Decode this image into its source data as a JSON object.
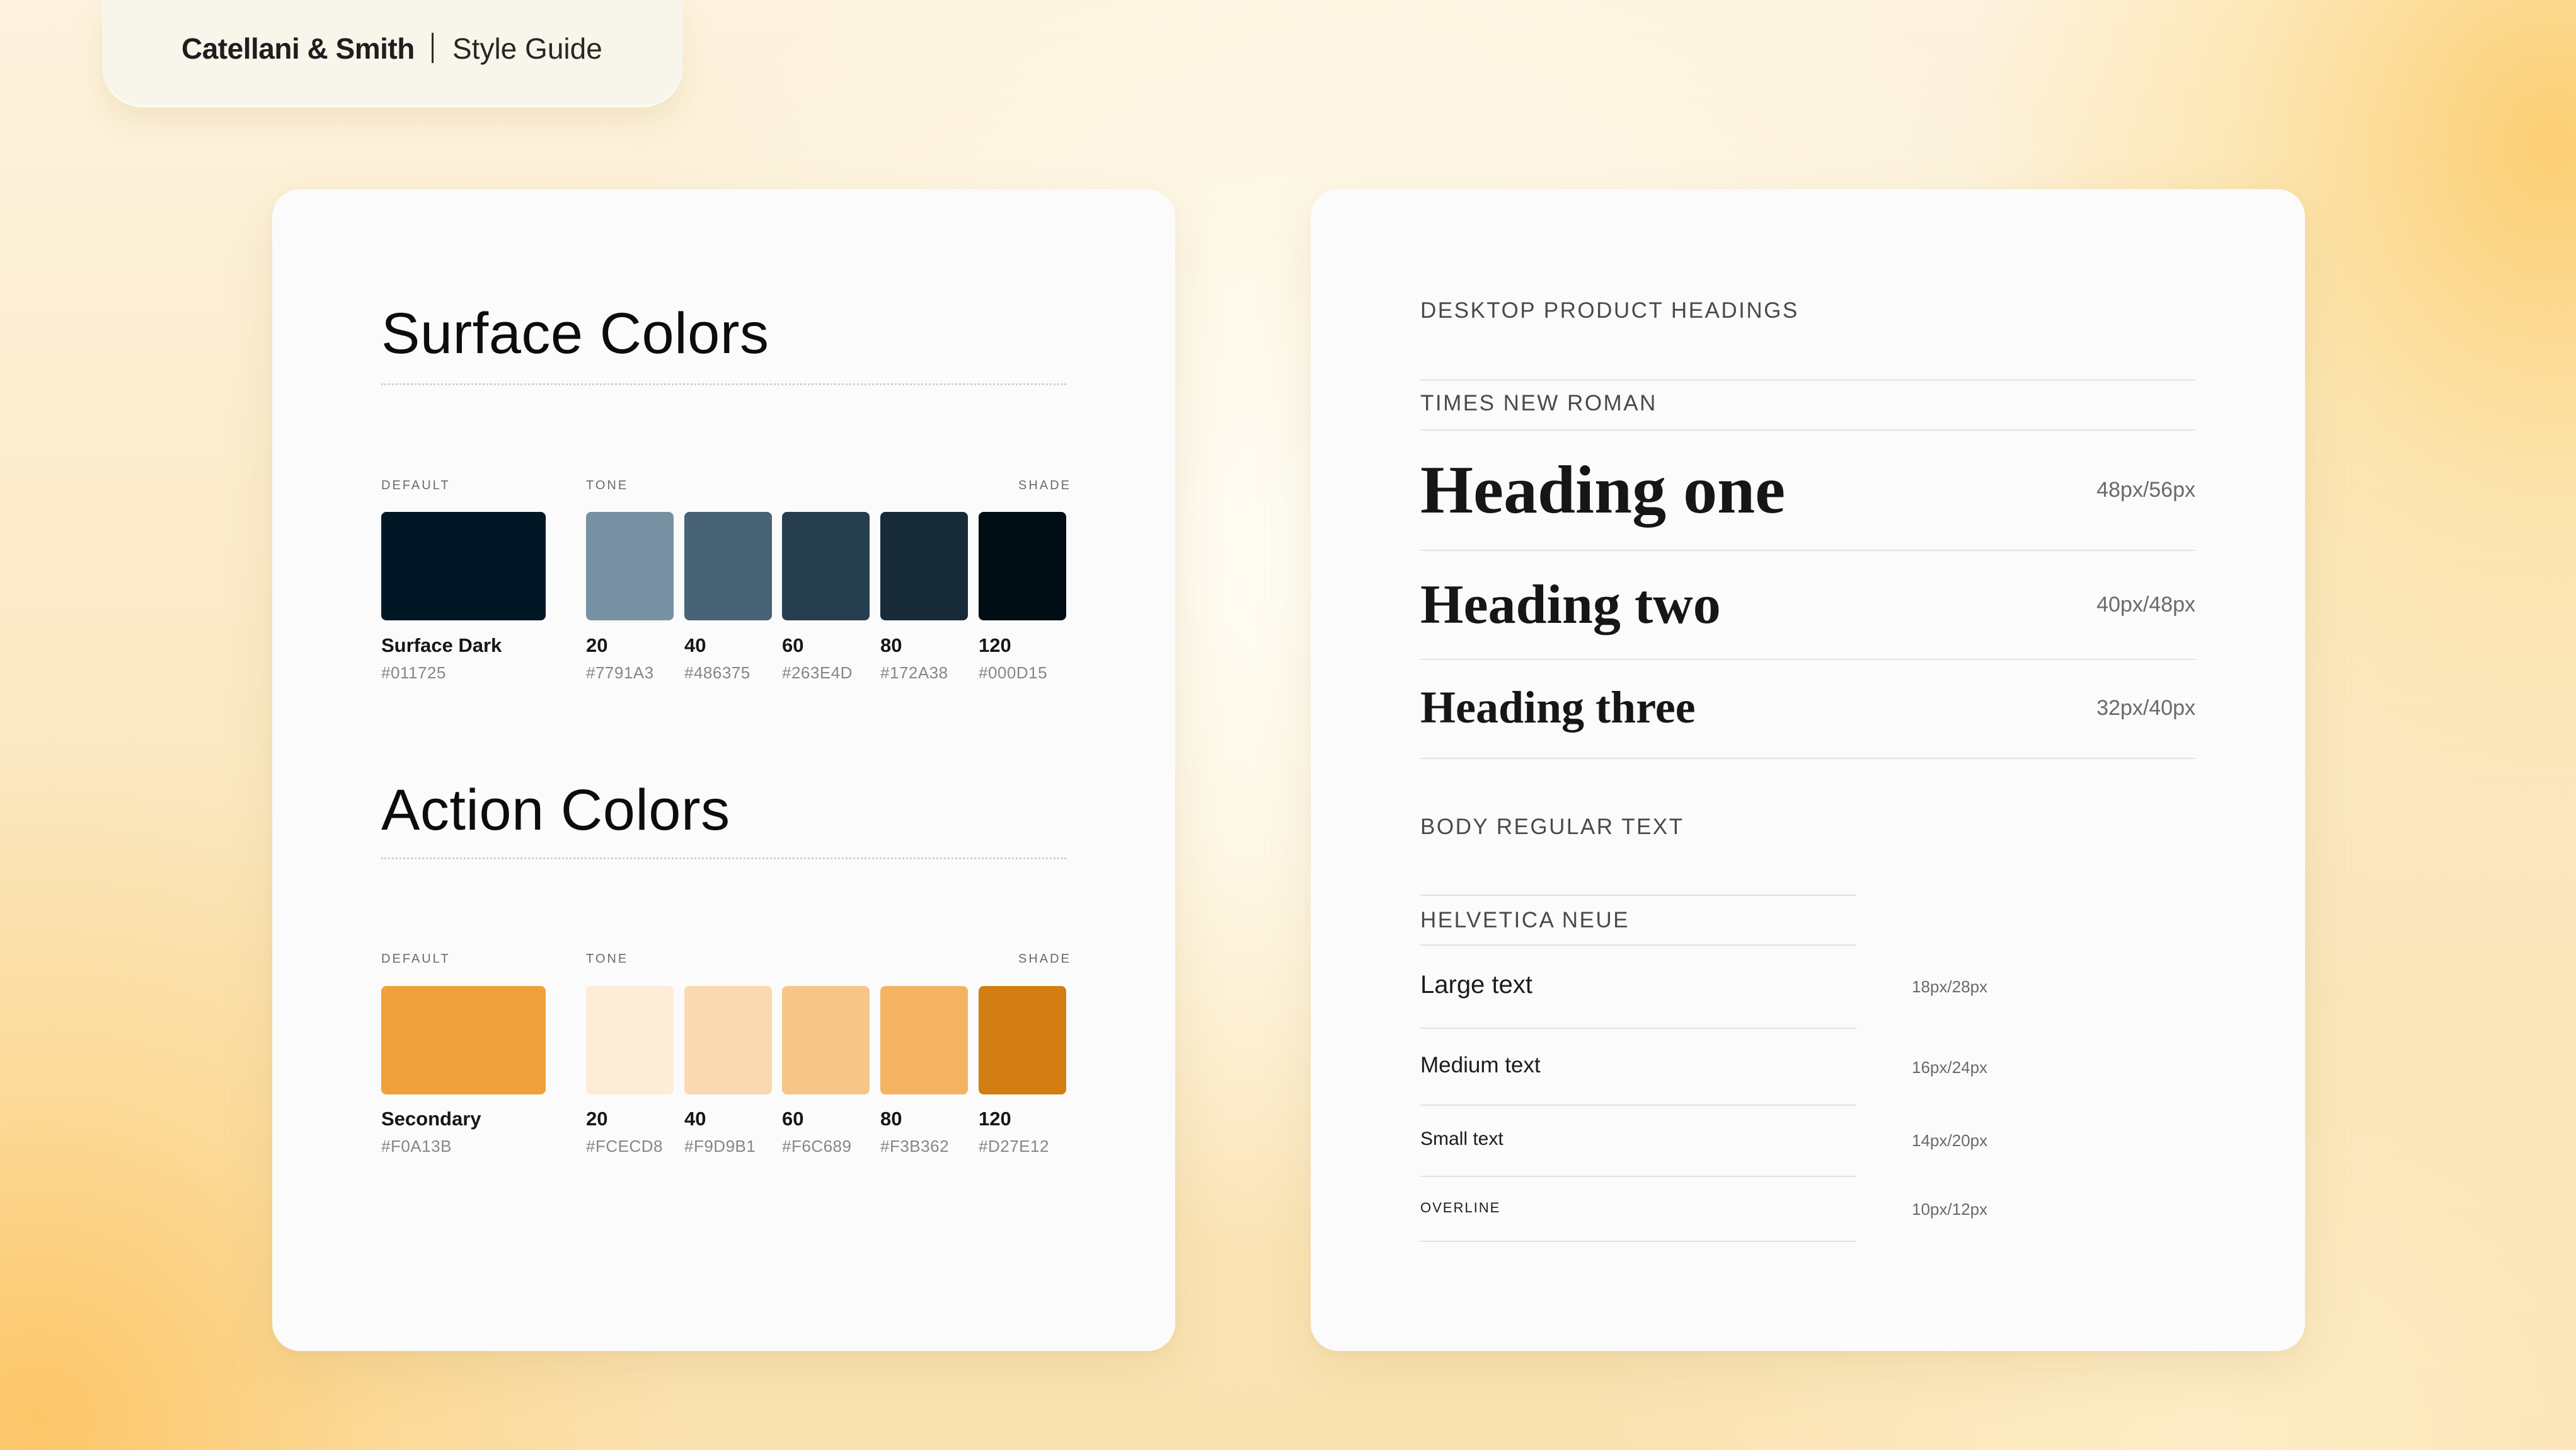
{
  "brand": {
    "company": "Catellani & Smith",
    "section": "Style Guide"
  },
  "surface": {
    "title": "Surface Colors",
    "default_label": "DEFAULT",
    "tone_label": "TONE",
    "shade_label": "SHADE",
    "default": {
      "name": "Surface Dark",
      "hex": "#011725",
      "color": "#011725"
    },
    "tones": [
      {
        "name": "20",
        "hex": "#7791A3",
        "color": "#7791A3"
      },
      {
        "name": "40",
        "hex": "#486375",
        "color": "#486375"
      },
      {
        "name": "60",
        "hex": "#263E4D",
        "color": "#263E4D"
      },
      {
        "name": "80",
        "hex": "#172A38",
        "color": "#172A38"
      },
      {
        "name": "120",
        "hex": "#000D15",
        "color": "#000D15"
      }
    ]
  },
  "action": {
    "title": "Action Colors",
    "default_label": "DEFAULT",
    "tone_label": "TONE",
    "shade_label": "SHADE",
    "default": {
      "name": "Secondary",
      "hex": "#F0A13B",
      "color": "#F0A13B"
    },
    "tones": [
      {
        "name": "20",
        "hex": "#FCECD8",
        "color": "#FCECD8"
      },
      {
        "name": "40",
        "hex": "#F9D9B1",
        "color": "#F9D9B1"
      },
      {
        "name": "60",
        "hex": "#F6C689",
        "color": "#F6C689"
      },
      {
        "name": "80",
        "hex": "#F3B362",
        "color": "#F3B362"
      },
      {
        "name": "120",
        "hex": "#D27E12",
        "color": "#D27E12"
      }
    ]
  },
  "typography": {
    "headings_label": "DESKTOP PRODUCT HEADINGS",
    "headings_font": "TIMES NEW ROMAN",
    "headings": [
      {
        "text": "Heading one",
        "spec": "48px/56px"
      },
      {
        "text": "Heading two",
        "spec": "40px/48px"
      },
      {
        "text": "Heading three",
        "spec": "32px/40px"
      }
    ],
    "body_label": "BODY REGULAR TEXT",
    "body_font": "HELVETICA NEUE",
    "body": [
      {
        "text": "Large text",
        "spec": "18px/28px"
      },
      {
        "text": "Medium text",
        "spec": "16px/24px"
      },
      {
        "text": "Small text",
        "spec": "14px/20px"
      },
      {
        "text": "OVERLINE",
        "spec": "10px/12px"
      }
    ]
  }
}
